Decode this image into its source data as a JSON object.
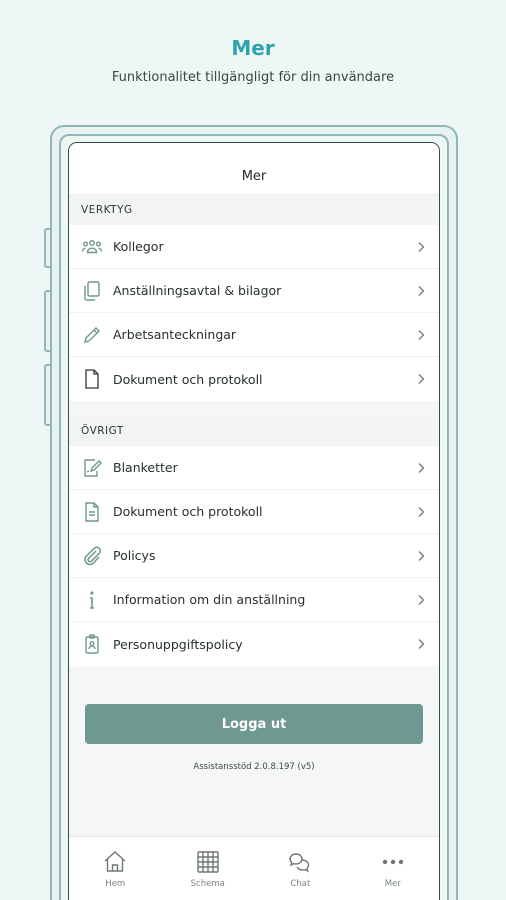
{
  "promo": {
    "title": "Mer",
    "subtitle": "Funktionalitet tillgängligt för din användare"
  },
  "header": {
    "title": "Mer"
  },
  "sections": [
    {
      "title": "VERKTYG",
      "items": [
        {
          "label": "Kollegor",
          "icon": "colleagues-icon"
        },
        {
          "label": "Anställningsavtal & bilagor",
          "icon": "documents-copy-icon"
        },
        {
          "label": "Arbetsanteckningar",
          "icon": "pencil-icon"
        },
        {
          "label": "Dokument och protokoll",
          "icon": "document-icon"
        }
      ]
    },
    {
      "title": "ÖVRIGT",
      "items": [
        {
          "label": "Blanketter",
          "icon": "form-edit-icon"
        },
        {
          "label": "Dokument och protokoll",
          "icon": "document-lines-icon"
        },
        {
          "label": "Policys",
          "icon": "paperclip-icon"
        },
        {
          "label": "Information om din anställning",
          "icon": "info-icon"
        },
        {
          "label": "Personuppgiftspolicy",
          "icon": "id-badge-icon"
        }
      ]
    }
  ],
  "logout": {
    "label": "Logga ut"
  },
  "version": "Assistansstöd 2.0.8.197 (v5)",
  "tabs": [
    {
      "label": "Hem",
      "icon": "home-icon"
    },
    {
      "label": "Schema",
      "icon": "calendar-icon"
    },
    {
      "label": "Chat",
      "icon": "chat-icon"
    },
    {
      "label": "Mer",
      "icon": "more-dots-icon"
    }
  ],
  "colors": {
    "accent": "#2ea3ad",
    "button": "#6e9890",
    "icon": "#6e9890",
    "background": "#eef7f6"
  }
}
